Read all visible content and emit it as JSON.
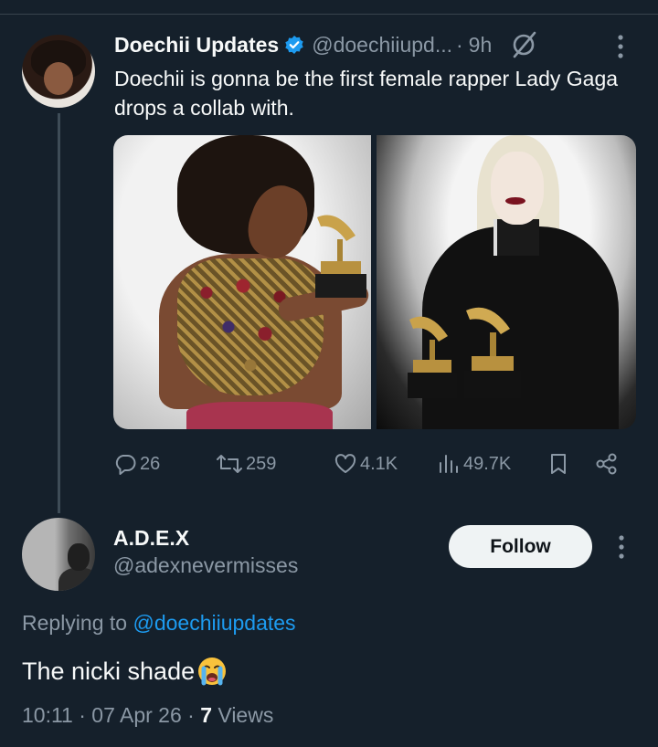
{
  "tweet": {
    "author_name": "Doechii Updates",
    "author_handle": "@doechiiupd...",
    "separator": "·",
    "time": "9h",
    "text": "Doechii is gonna be the first female rapper Lady Gaga drops a collab with.",
    "stats": {
      "replies": "26",
      "retweets": "259",
      "likes": "4.1K",
      "views": "49.7K"
    }
  },
  "reply": {
    "author_name": "A.D.E.X",
    "author_handle": "@adexnevermisses",
    "follow_label": "Follow",
    "replying_prefix": "Replying to",
    "replying_handle": "@doechiiupdates",
    "text": "The nicki shade",
    "meta_time": "10:11 · 07 Apr 26 ·",
    "meta_views_count": "7",
    "meta_views_label": "Views"
  },
  "colors": {
    "background": "#15202b",
    "text_primary": "#f7f9f9",
    "text_secondary": "#8b98a5",
    "accent": "#1d9bf0"
  },
  "icons": {
    "verified": "verified-badge-icon",
    "grok": "grok-icon",
    "more": "more-vertical-icon",
    "reply": "reply-icon",
    "retweet": "retweet-icon",
    "like": "heart-icon",
    "views": "views-icon",
    "bookmark": "bookmark-icon",
    "share": "share-icon",
    "emoji": "loudly-crying-face-icon"
  }
}
